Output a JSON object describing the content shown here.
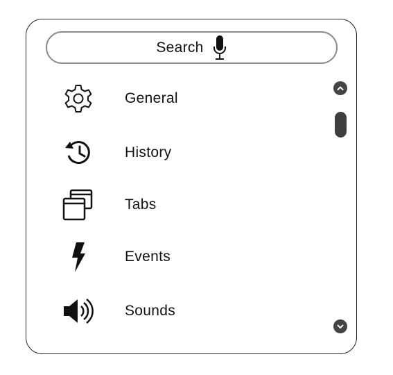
{
  "search": {
    "label": "Search",
    "icon": "microphone-icon"
  },
  "menu": {
    "items": [
      {
        "label": "General",
        "icon": "gear-icon"
      },
      {
        "label": "History",
        "icon": "history-icon"
      },
      {
        "label": "Tabs",
        "icon": "tabs-icon"
      },
      {
        "label": "Events",
        "icon": "lightning-icon"
      },
      {
        "label": "Sounds",
        "icon": "speaker-icon"
      }
    ]
  },
  "scrollbar": {
    "up_icon": "chevron-up-icon",
    "down_icon": "chevron-down-icon"
  },
  "colors": {
    "text": "#111111",
    "border": "#222222",
    "search_border": "#8a8a8a",
    "scroll": "#444444"
  }
}
